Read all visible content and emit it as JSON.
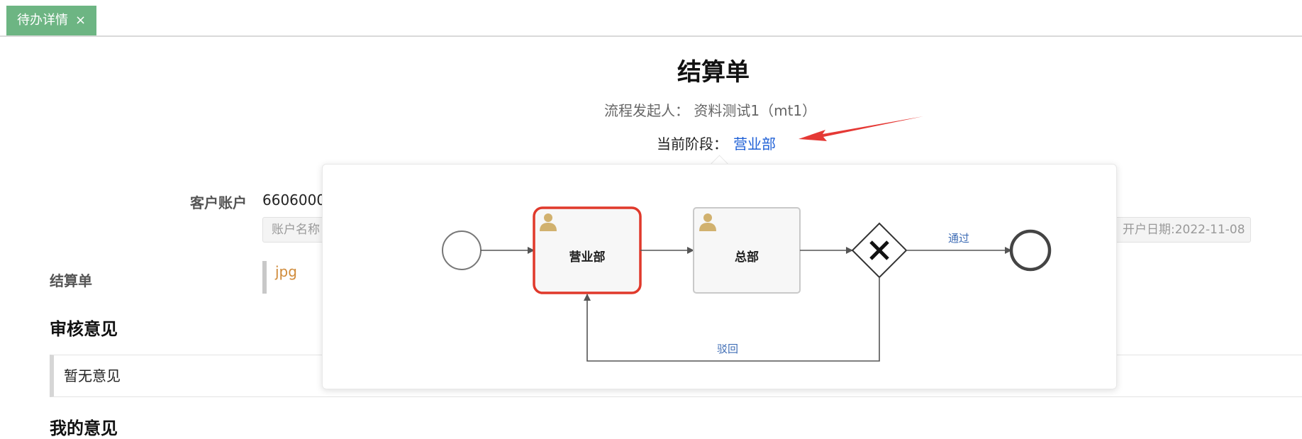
{
  "tab": {
    "label": "待办详情",
    "close": "×"
  },
  "document": {
    "title": "结算单",
    "starter_label": "流程发起人：",
    "starter_value": "资料测试1（mt1）",
    "stage_label": "当前阶段：",
    "stage_value": "营业部"
  },
  "form": {
    "account_label": "客户账户",
    "account_value": "6606000",
    "account_name_placeholder": "账户名称",
    "open_date": "开户日期:2022-11-08",
    "settlement_label": "结算单",
    "file_name": "jpg",
    "review_heading": "审核意见",
    "review_text": "暂无意见",
    "my_opinion_heading": "我的意见"
  },
  "flow": {
    "task_dept": "营业部",
    "task_hq": "总部",
    "edge_pass": "通过",
    "edge_reject": "驳回"
  },
  "colors": {
    "tab_bg": "#6db583",
    "active_task_border": "#e0392b",
    "link": "#1e5fd6",
    "flow_label": "#3f6db5"
  }
}
